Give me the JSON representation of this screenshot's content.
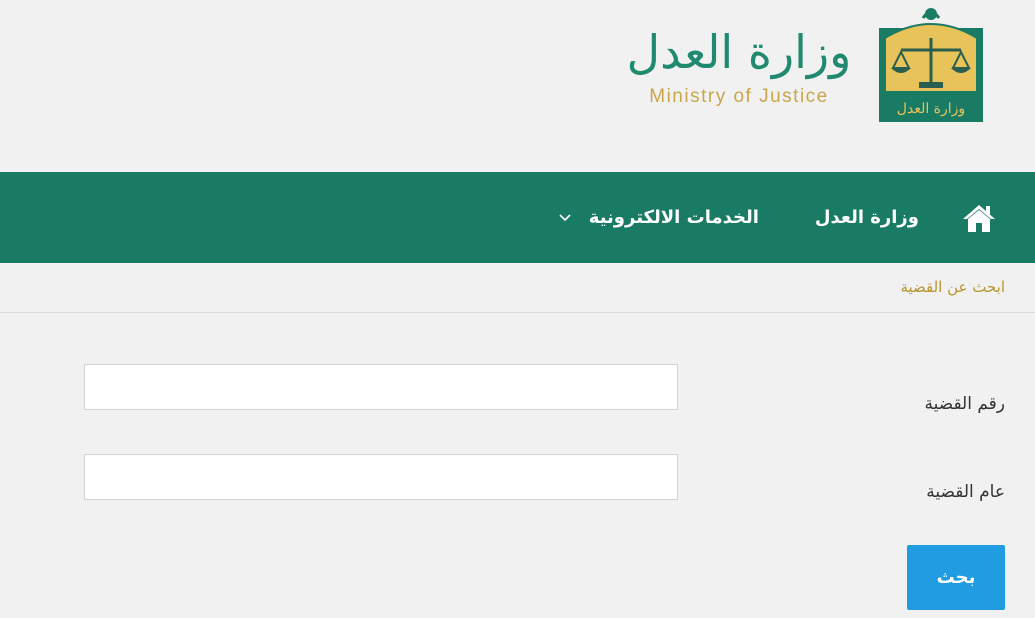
{
  "logo": {
    "arabic_name": "وزارة العدل",
    "english_name": "Ministry of Justice",
    "emblem_text": "وزارة العدل",
    "colors": {
      "green": "#1f8a6f",
      "gold": "#c9a64a"
    }
  },
  "nav": {
    "home_icon": "home-icon",
    "items": [
      {
        "label": "وزارة العدل"
      },
      {
        "label": "الخدمات الالكترونية",
        "has_dropdown": true
      }
    ],
    "background": "#1a7b65"
  },
  "breadcrumb": {
    "label": "ابحث عن القضية"
  },
  "form": {
    "case_number_label": "رقم القضية",
    "case_number_value": "",
    "case_year_label": "عام القضية",
    "case_year_value": "",
    "search_button_label": "بحث",
    "button_color": "#1f9de0"
  }
}
